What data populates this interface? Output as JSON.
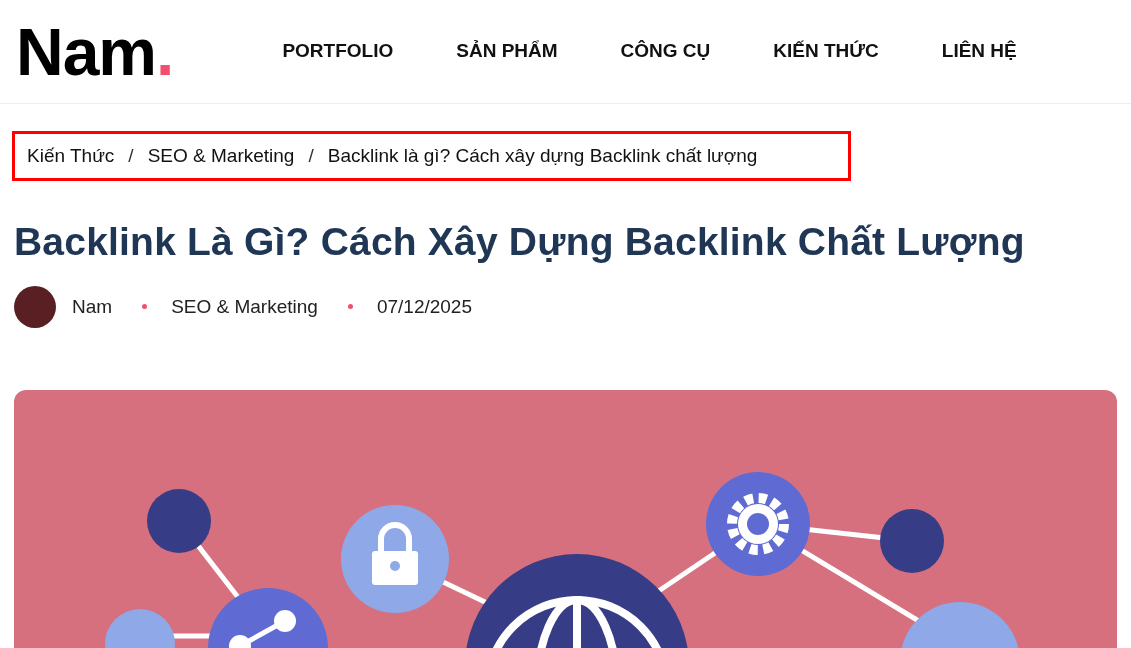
{
  "logo": {
    "text": "Nam",
    "dot": "."
  },
  "nav": [
    {
      "label": "PORTFOLIO"
    },
    {
      "label": "SẢN PHẨM"
    },
    {
      "label": "CÔNG CỤ"
    },
    {
      "label": "KIẾN THỨC"
    },
    {
      "label": "LIÊN HỆ"
    }
  ],
  "breadcrumb": {
    "separator": "/",
    "items": [
      "Kiến Thức",
      "SEO & Marketing",
      "Backlink là gì? Cách xây dựng Backlink chất lượng"
    ]
  },
  "article": {
    "title": "Backlink Là Gì? Cách Xây Dựng Backlink Chất Lượng",
    "author": "Nam",
    "category": "SEO & Marketing",
    "date": "07/12/2025"
  }
}
